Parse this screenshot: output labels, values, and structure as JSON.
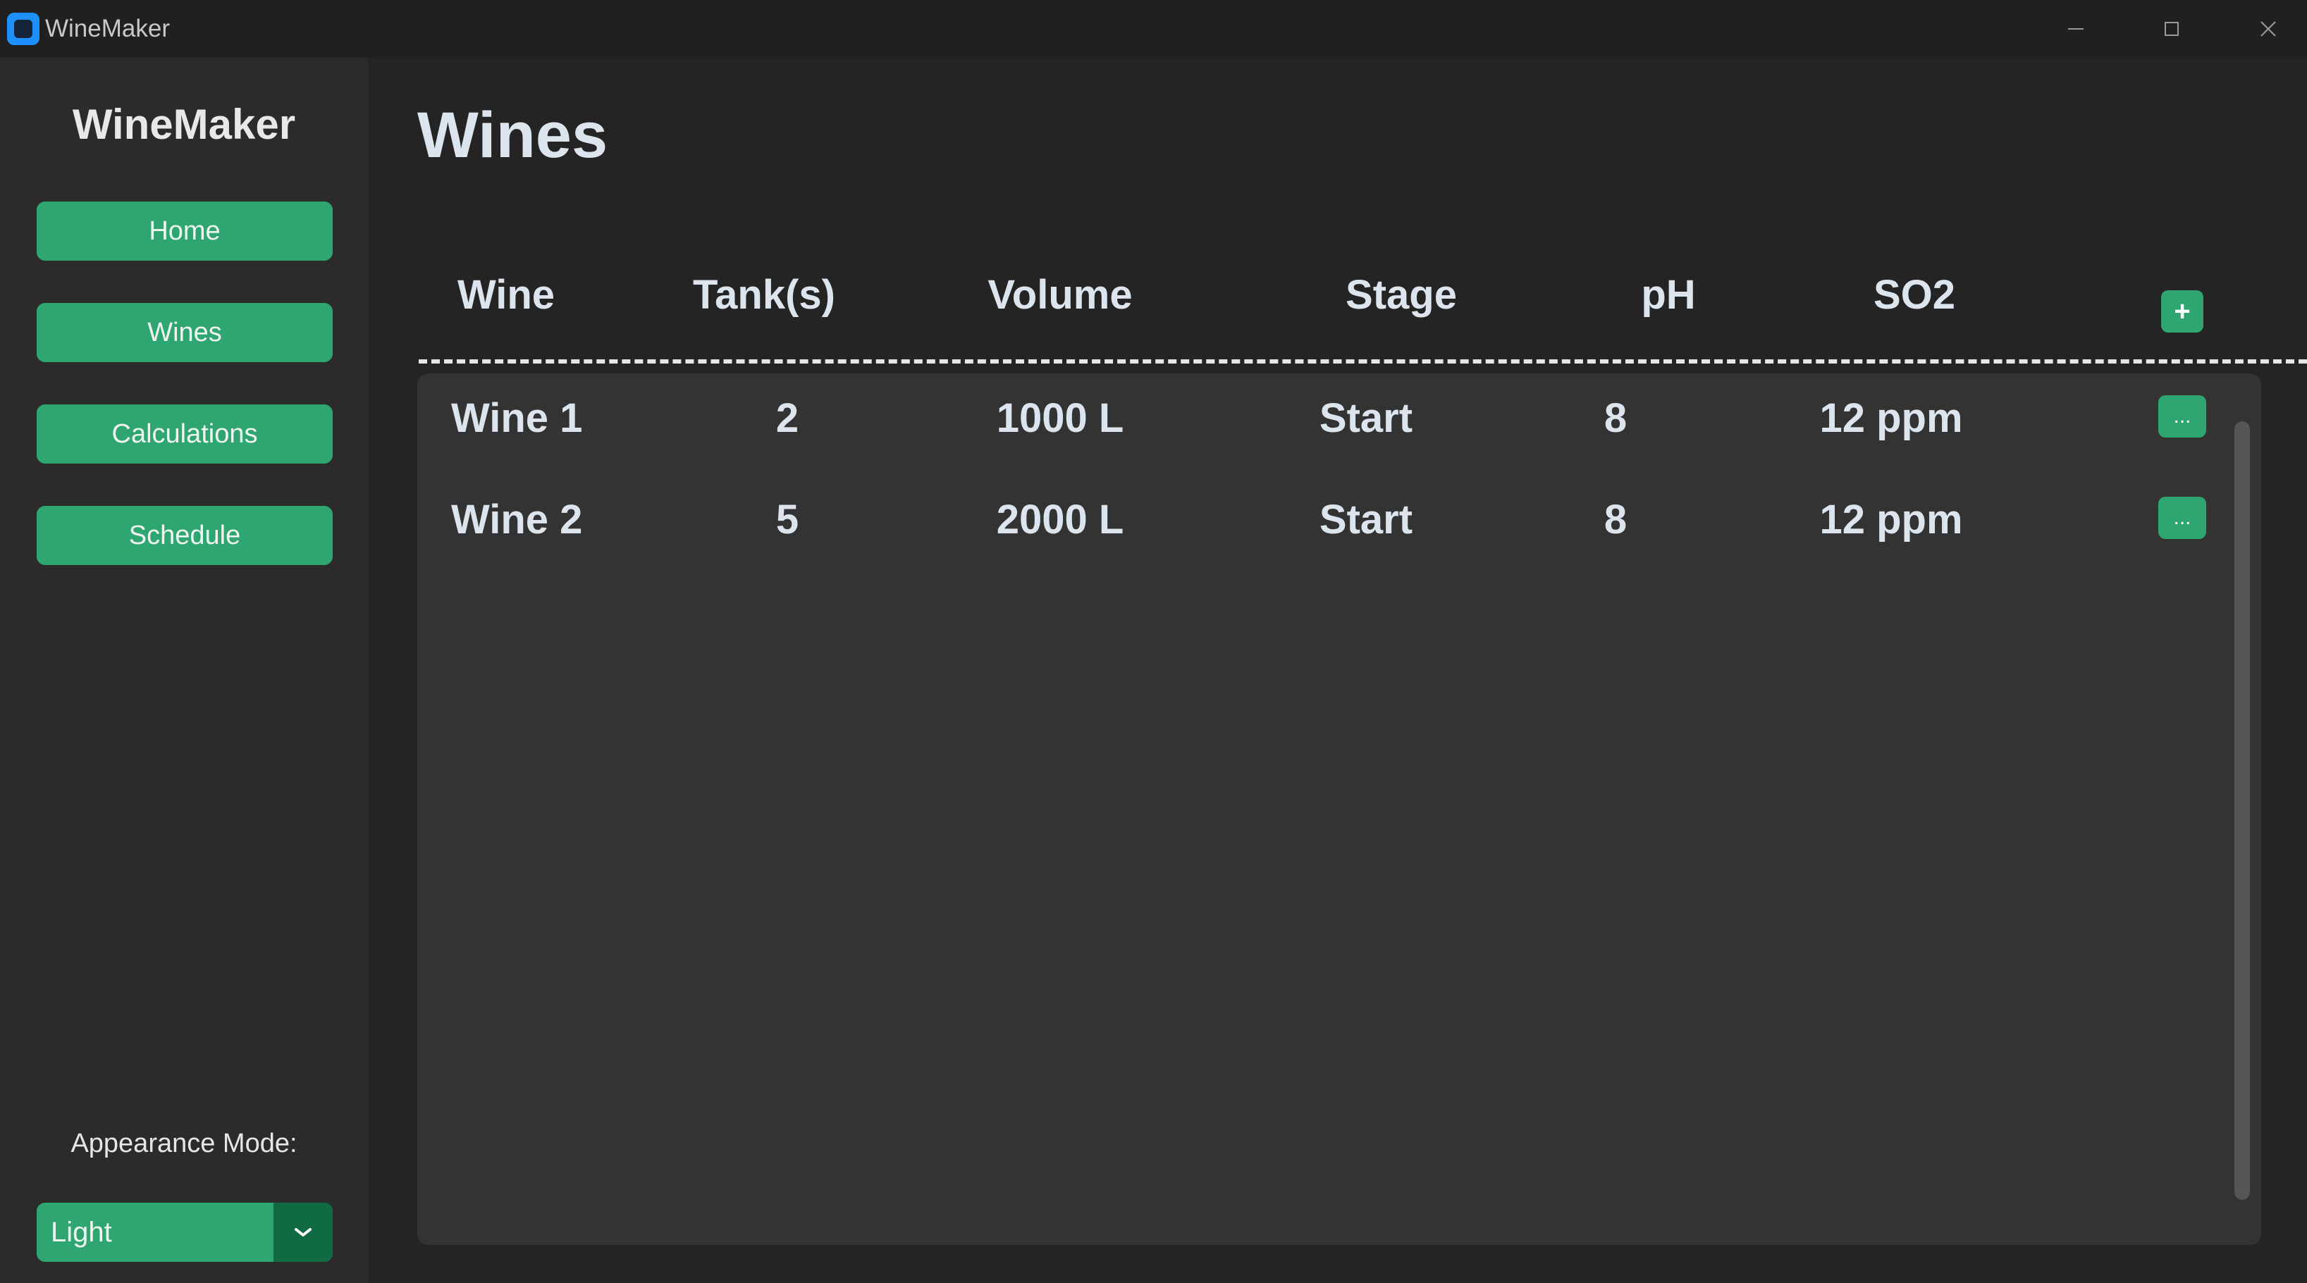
{
  "window": {
    "title": "WineMaker",
    "controls": [
      "minimize",
      "maximize",
      "close"
    ]
  },
  "sidebar": {
    "brand": "WineMaker",
    "nav": [
      {
        "label": "Home"
      },
      {
        "label": "Wines"
      },
      {
        "label": "Calculations"
      },
      {
        "label": "Schedule"
      }
    ],
    "appearance_label": "Appearance Mode:",
    "appearance_value": "Light"
  },
  "main": {
    "title": "Wines",
    "columns": [
      "Wine",
      "Tank(s)",
      "Volume",
      "Stage",
      "pH",
      "SO2"
    ],
    "add_label": "+",
    "row_menu_label": "...",
    "rows": [
      {
        "wine": "Wine 1",
        "tanks": "2",
        "volume": "1000 L",
        "stage": "Start",
        "ph": "8",
        "so2": "12 ppm"
      },
      {
        "wine": "Wine 2",
        "tanks": "5",
        "volume": "2000 L",
        "stage": "Start",
        "ph": "8",
        "so2": "12 ppm"
      }
    ]
  },
  "colors": {
    "accent": "#2fa572",
    "accent_dark": "#106a43",
    "background": "#242424",
    "sidebar": "#2b2b2b",
    "table": "#333333",
    "text": "#dce4ee"
  }
}
